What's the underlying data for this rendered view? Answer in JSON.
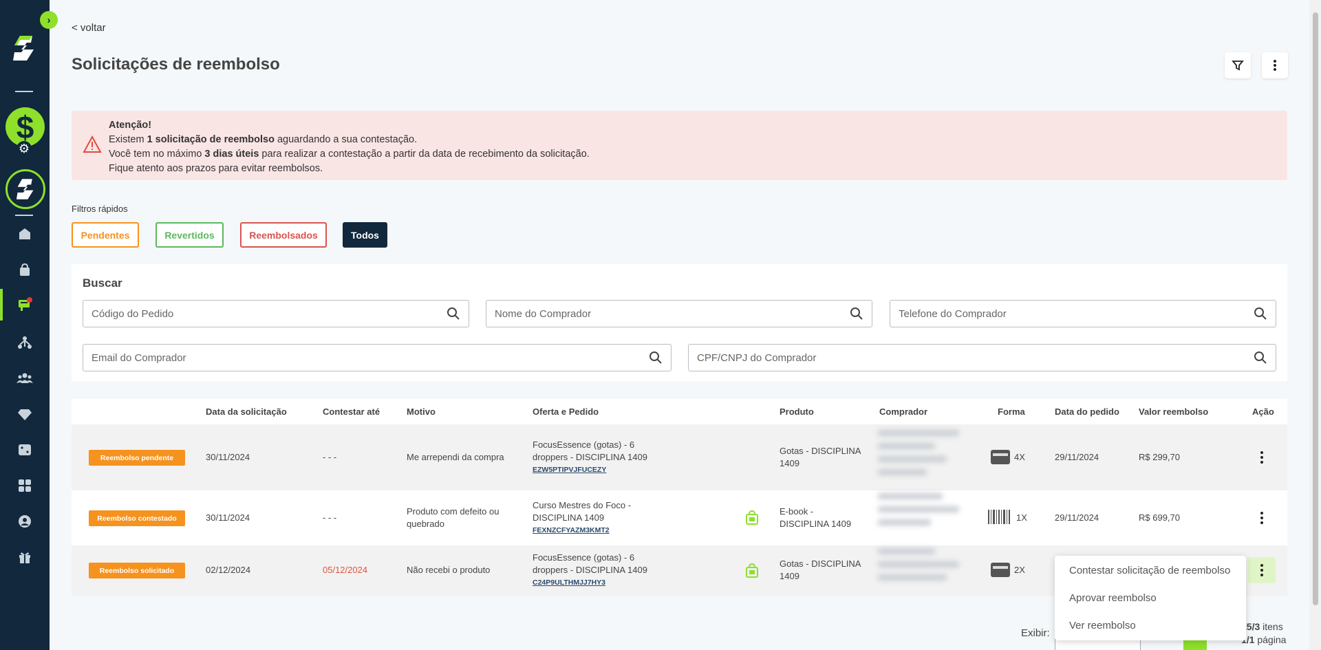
{
  "colors": {
    "brand_dark": "#11283d",
    "brand_green": "#8ee02b",
    "pending": "#f6921e",
    "reverted": "#5cb85c",
    "refunded": "#d9534f",
    "alert_bg": "#fae5e5"
  },
  "sidebar": {
    "icons": [
      "chevron-right-icon",
      "logo-icon",
      "dollar-icon",
      "gear-icon",
      "logo-ring-icon",
      "home-icon",
      "bag-icon",
      "refund-icon",
      "network-icon",
      "users-icon",
      "diamond-icon",
      "dice-icon",
      "apps-icon",
      "profile-icon",
      "gift-icon"
    ]
  },
  "header": {
    "back_label": "< voltar",
    "title": "Solicitações de reembolso"
  },
  "alert": {
    "title": "Atenção!",
    "line1_pre": "Existem ",
    "line1_bold": "1 solicitação de reembolso",
    "line1_post": " aguardando a sua contestação.",
    "line2_pre": "Você tem no máximo ",
    "line2_bold": "3 dias úteis",
    "line2_post": " para realizar a contestação a partir da data de recebimento da solicitação.",
    "line3": "Fique atento aos prazos para evitar reembolsos."
  },
  "quick_filters": {
    "label": "Filtros rápidos",
    "pending": "Pendentes",
    "reverted": "Revertidos",
    "refunded": "Reembolsados",
    "all": "Todos"
  },
  "search": {
    "title": "Buscar",
    "order_code": "Código do Pedido",
    "buyer_name": "Nome do Comprador",
    "buyer_phone": "Telefone do Comprador",
    "buyer_email": "Email do Comprador",
    "buyer_doc": "CPF/CNPJ do Comprador"
  },
  "table": {
    "headers": {
      "date": "Data da solicitação",
      "contest_until": "Contestar até",
      "reason": "Motivo",
      "offer": "Oferta e Pedido",
      "product": "Produto",
      "buyer": "Comprador",
      "method": "Forma",
      "order_date": "Data do pedido",
      "amount": "Valor reembolso",
      "action": "Ação"
    },
    "rows": [
      {
        "status": "Reembolso pendente",
        "date": "30/11/2024",
        "contest_until": "- - -",
        "reason": "Me arrependi da compra",
        "offer": "FocusEssence (gotas) - 6 droppers - DISCIPLINA 1409",
        "order_code": "EZW5PTIPVJFUCEZY",
        "product": "Gotas - DISCIPLINA 1409",
        "method_icon": "credit-card-icon",
        "installments": "4X",
        "order_date": "29/11/2024",
        "amount": "R$ 299,70"
      },
      {
        "status": "Reembolso contestado",
        "date": "30/11/2024",
        "contest_until": "- - -",
        "reason": "Produto com defeito ou quebrado",
        "offer": "Curso Mestres do Foco - DISCIPLINA 1409",
        "order_code": "FEXNZCFYAZM3KMT2",
        "product": "E-book - DISCIPLINA 1409",
        "method_icon": "barcode-icon",
        "installments": "1X",
        "order_date": "29/11/2024",
        "amount": "R$ 699,70"
      },
      {
        "status": "Reembolso solicitado",
        "date": "02/12/2024",
        "contest_until": "05/12/2024",
        "reason": "Não recebi o produto",
        "offer": "FocusEssence (gotas) - 6 droppers - DISCIPLINA 1409",
        "order_code": "C24P9ULTHMJJ7HY3",
        "product": "Gotas - DISCIPLINA 1409",
        "method_icon": "credit-card-icon",
        "installments": "2X"
      }
    ]
  },
  "action_menu": {
    "contest": "Contestar solicitação de reembolso",
    "approve": "Aprovar reembolso",
    "view": "Ver reembolso"
  },
  "pagination": {
    "show_label": "Exibir:",
    "items_count": "25/3",
    "items_label": " itens",
    "pages_count": "1/1",
    "pages_label": " página"
  }
}
